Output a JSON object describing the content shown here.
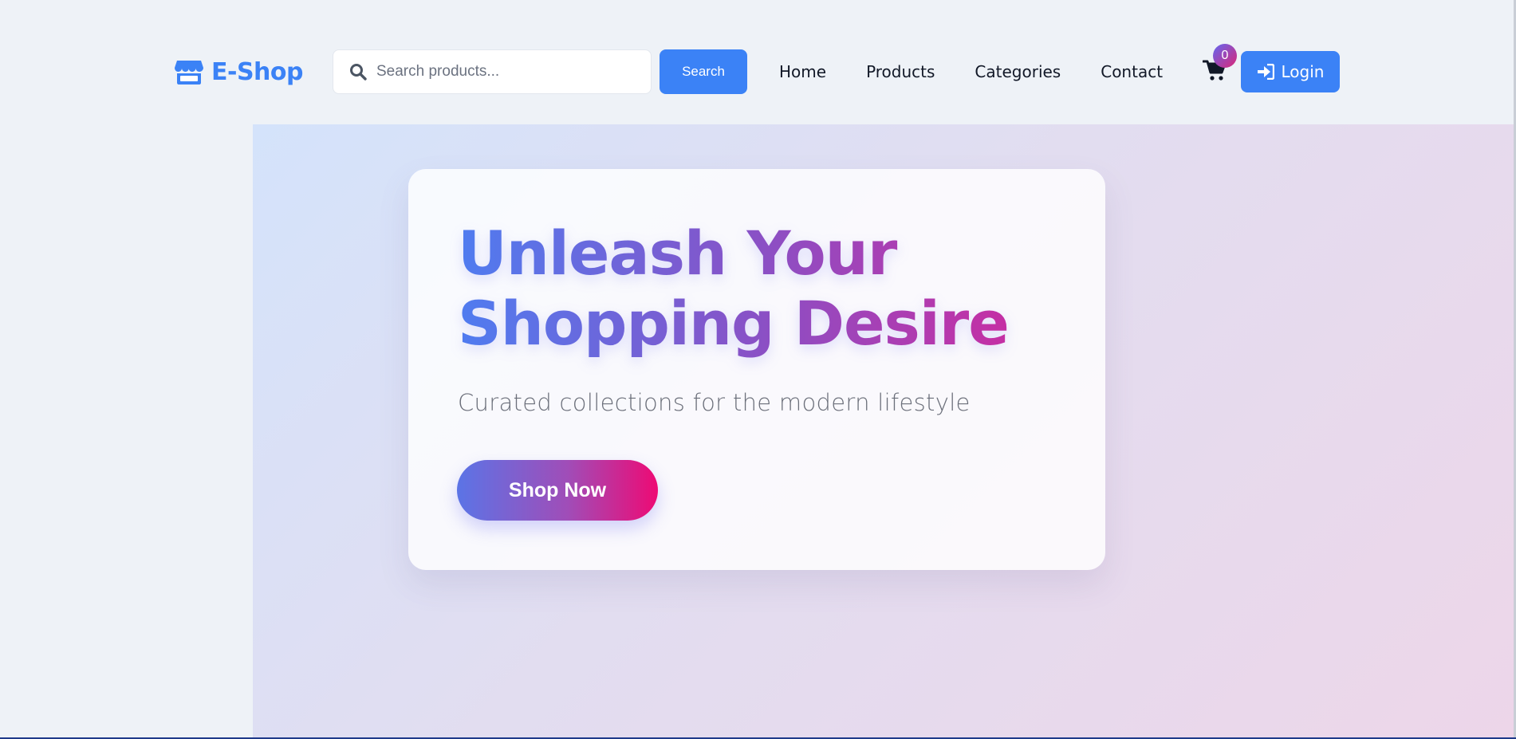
{
  "brand": {
    "name": "E-Shop",
    "color": "#3b82f6",
    "icon": "store-icon"
  },
  "search": {
    "placeholder": "Search products...",
    "value": "",
    "button_label": "Search",
    "icon": "search-icon"
  },
  "nav": {
    "items": [
      {
        "label": "Home"
      },
      {
        "label": "Products"
      },
      {
        "label": "Categories"
      },
      {
        "label": "Contact"
      }
    ]
  },
  "cart": {
    "icon": "cart-icon",
    "count": "0"
  },
  "login": {
    "label": "Login",
    "icon": "login-icon",
    "color": "#3b82f6"
  },
  "hero": {
    "title_line1": "Unleash Your",
    "title_line2": "Shopping Desire",
    "subtitle": "Curated collections for the modern lifestyle",
    "cta_label": "Shop Now",
    "gradient_start": "#4f7cf0",
    "gradient_end": "#ee0a74"
  }
}
